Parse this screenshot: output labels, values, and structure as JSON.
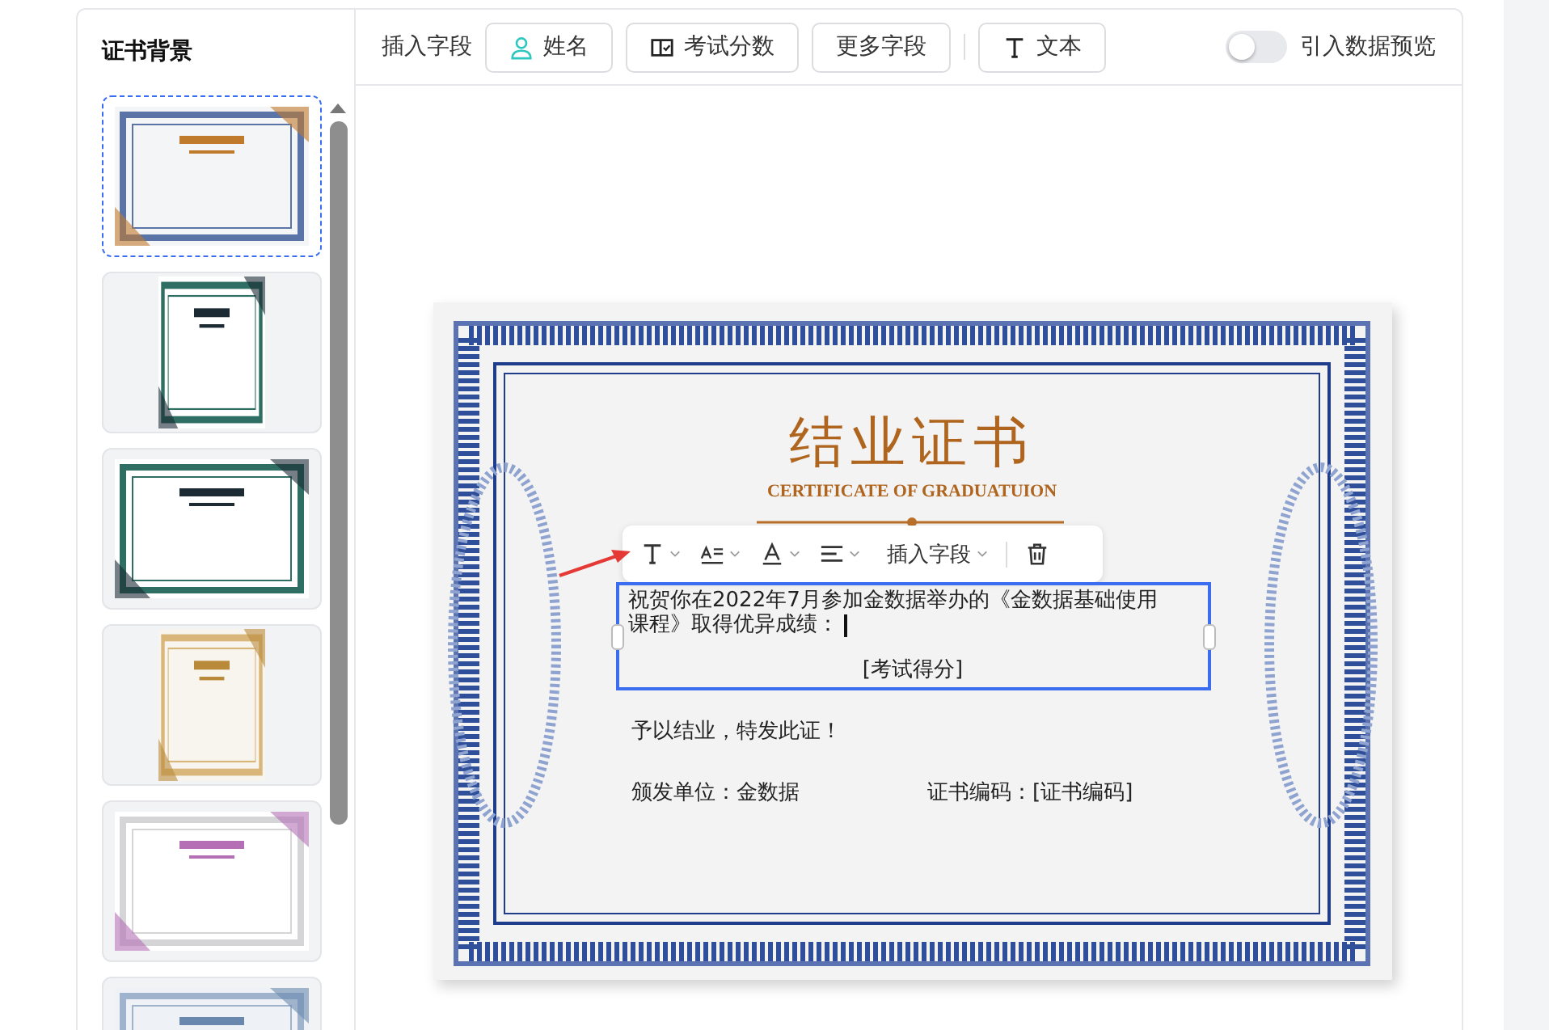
{
  "sidebar": {
    "title": "证书背景",
    "templates": [
      {
        "kind": "blue-guilloche",
        "selected": true
      },
      {
        "kind": "green-portrait",
        "selected": false
      },
      {
        "kind": "green-landscape",
        "selected": false
      },
      {
        "kind": "gold-portrait",
        "selected": false
      },
      {
        "kind": "purple-lines",
        "selected": false
      },
      {
        "kind": "blue-pattern",
        "selected": false
      }
    ]
  },
  "toolbar": {
    "label": "插入字段",
    "buttons": [
      {
        "kind": "person",
        "label": "姓名"
      },
      {
        "kind": "book",
        "label": "考试分数"
      },
      {
        "kind": "plain",
        "label": "更多字段"
      },
      {
        "kind": "text",
        "label": "文本"
      }
    ],
    "preview_toggle": {
      "label": "引入数据预览",
      "on": false
    }
  },
  "certificate": {
    "title": "结业证书",
    "subtitle": "CERTIFICATE OF GRADUATUION",
    "format_bar": {
      "field_menu": "插入字段"
    },
    "text_box": {
      "selected": true,
      "paragraph_lines": [
        "祝贺你在2022年7月参加金数据举办的《金数据基础使用",
        "课程》取得优异成绩："
      ],
      "field": "[考试得分]"
    },
    "body": "予以结业，特发此证！",
    "issuer": "颁发单位：金数据",
    "code": "证书编码：[证书编码]"
  }
}
